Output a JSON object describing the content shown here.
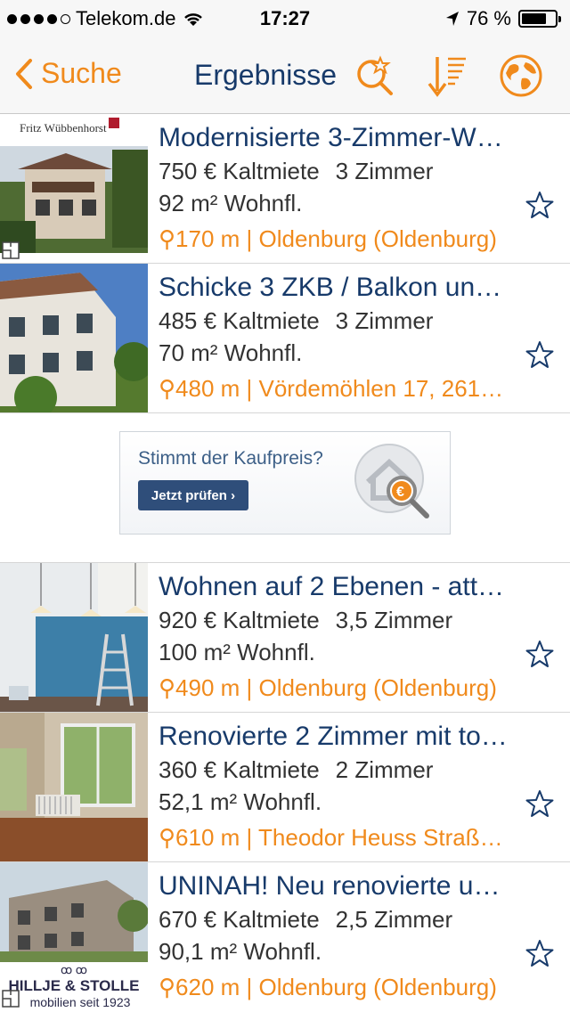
{
  "status_bar": {
    "carrier": "Telekom.de",
    "time": "17:27",
    "battery_text": "76 %",
    "battery_level": 0.76
  },
  "nav": {
    "back_label": "Suche",
    "title": "Ergebnisse",
    "icons": [
      "saved-search-icon",
      "sort-icon",
      "map-globe-icon"
    ]
  },
  "colors": {
    "accent": "#f08a1c",
    "title_blue": "#173a6a"
  },
  "listings": [
    {
      "title": "Modernisierte 3-Zimmer-W…",
      "rent": "750 € Kaltmiete",
      "rooms": "3 Zimmer",
      "area": "92 m² Wohnfl.",
      "location": "170 m | Oldenburg (Oldenburg)",
      "thumb_logo": "Fritz Wübbenhorst"
    },
    {
      "title": "Schicke 3 ZKB / Balkon un…",
      "rent": "485 € Kaltmiete",
      "rooms": "3 Zimmer",
      "area": "70 m² Wohnfl.",
      "location": "480 m | Vördemöhlen 17, 261…"
    },
    {
      "title": "Wohnen auf 2 Ebenen - att…",
      "rent": "920 € Kaltmiete",
      "rooms": "3,5 Zimmer",
      "area": "100 m² Wohnfl.",
      "location": "490 m | Oldenburg (Oldenburg)"
    },
    {
      "title": "Renovierte 2 Zimmer mit to…",
      "rent": "360 € Kaltmiete",
      "rooms": "2 Zimmer",
      "area": "52,1 m² Wohnfl.",
      "location": "610 m | Theodor Heuss Straß…"
    },
    {
      "title": "UNINAH! Neu renovierte u…",
      "rent": "670 € Kaltmiete",
      "rooms": "2,5 Zimmer",
      "area": "90,1 m² Wohnfl.",
      "location": "620 m | Oldenburg (Oldenburg)",
      "thumb_logo": "HILLJE & STOLLE",
      "thumb_logo_sub": "mobilien seit 1923"
    }
  ],
  "ad": {
    "headline": "Stimmt der Kaufpreis?",
    "button": "Jetzt prüfen ›"
  }
}
